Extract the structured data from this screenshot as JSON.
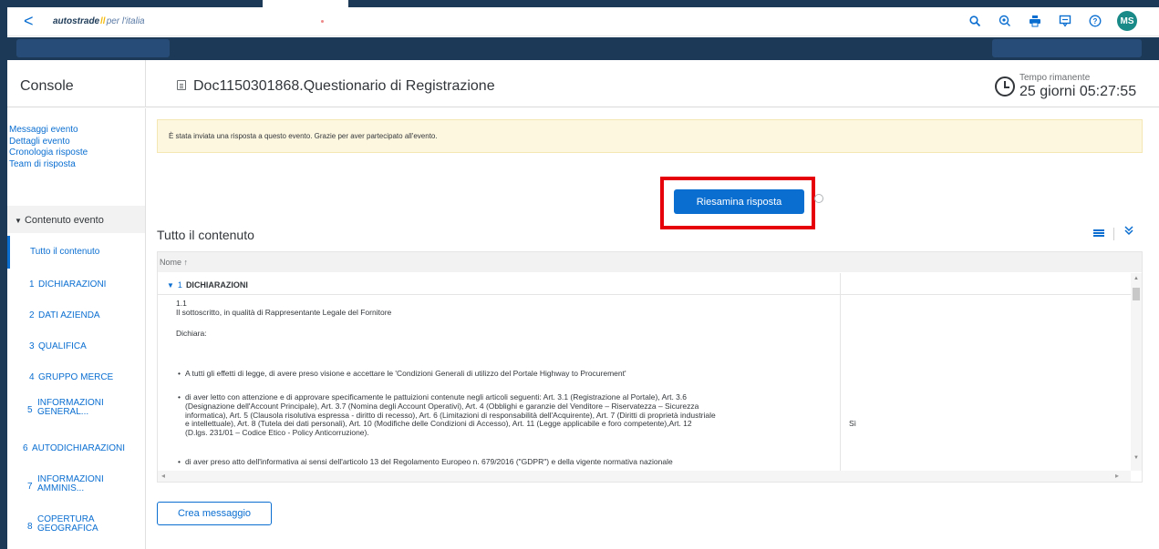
{
  "shell": {
    "back_glyph": "<",
    "logo_brand": "autostrade",
    "logo_sep": "//",
    "logo_tail": "per l'italia",
    "avatar_initials": "MS",
    "icons": [
      "search-icon",
      "notification-icon",
      "print-icon",
      "feedback-icon",
      "help-icon"
    ]
  },
  "header": {
    "console_title": "Console",
    "doc_title": "Doc1150301868.Questionario di Registrazione",
    "time_label": "Tempo rimanente",
    "time_value": "25 giorni 05:27:55"
  },
  "sidebar": {
    "links": [
      "Messaggi evento",
      "Dettagli evento",
      "Cronologia risposte",
      "Team di risposta"
    ],
    "section_title": "Contenuto evento",
    "nav": [
      {
        "num": "",
        "label": "Tutto il contenuto"
      },
      {
        "num": "1",
        "label": "DICHIARAZIONI"
      },
      {
        "num": "2",
        "label": "DATI AZIENDA"
      },
      {
        "num": "3",
        "label": "QUALIFICA"
      },
      {
        "num": "4",
        "label": "GRUPPO MERCE"
      },
      {
        "num": "5",
        "label1": "INFORMAZIONI",
        "label2": "GENERAL..."
      },
      {
        "num": "6",
        "label": "AUTODICHIARAZIONI"
      },
      {
        "num": "7",
        "label1": "INFORMAZIONI",
        "label2": "AMMINIS..."
      },
      {
        "num": "8",
        "label1": "COPERTURA",
        "label2": "GEOGRAFICA"
      }
    ]
  },
  "main": {
    "info_message": "È stata inviata una risposta a questo evento. Grazie per aver partecipato all'evento.",
    "review_button": "Riesamina risposta",
    "content_title": "Tutto il contenuto",
    "create_button": "Crea messaggio"
  },
  "table": {
    "column_name": "Nome ↑",
    "group": {
      "num": "1",
      "name": "DICHIARAZIONI"
    },
    "item_num": "1.1",
    "item_text": "Il sottoscritto, in qualità di Rappresentante Legale del Fornitore",
    "dichiara": "Dichiara:",
    "bullet1": "A tutti gli effetti di legge, di avere preso visione e accettare le 'Condizioni Generali di utilizzo del Portale Highway to Procurement'",
    "bullet2_lines": [
      "di aver letto con attenzione e di approvare specificamente le pattuizioni contenute negli articoli seguenti: Art. 3.1 (Registrazione al Portale), Art. 3.6",
      "(Designazione dell'Account Principale), Art. 3.7 (Nomina degli Account Operativi), Art. 4 (Obblighi e garanzie del Venditore – Riservatezza – Sicurezza",
      "informatica), Art. 5 (Clausola risolutiva espressa - diritto di recesso), Art. 6 (Limitazioni di responsabilità dell'Acquirente), Art. 7 (Diritti di proprietà industriale",
      "e intellettuale), Art. 8 (Tutela dei dati personali), Art. 10 (Modifiche delle Condizioni di Accesso), Art. 11 (Legge applicabile e foro competente),Art. 12",
      "(D.lgs. 231/01 – Codice Etico - Policy Anticorruzione)."
    ],
    "bullet3": "di aver preso atto dell'informativa ai sensi dell'articolo 13 del Regolamento Europeo n. 679/2016 (\"GDPR\") e della vigente normativa nazionale",
    "answer": "Sì"
  }
}
